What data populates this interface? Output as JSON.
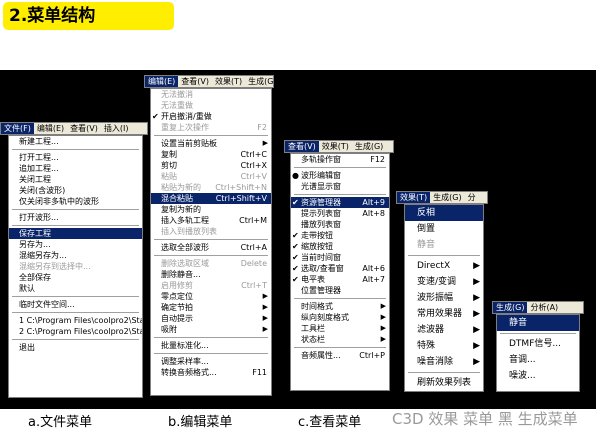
{
  "title": "2.菜单结构",
  "captions": [
    "a.文件菜单",
    "b.编辑菜单",
    "c.查看菜单",
    "d.效果菜单",
    "e.生成菜单"
  ],
  "watermark": "C3D 效果 菜单 黑 生成菜单",
  "file_menu": {
    "menubar": [
      "文件(F)",
      "编辑(E)",
      "查看(V)",
      "插入(I)"
    ],
    "items": [
      {
        "label": "新建工程..."
      },
      {
        "sep": true
      },
      {
        "label": "打开工程..."
      },
      {
        "label": "追加工程..."
      },
      {
        "label": "关闭工程"
      },
      {
        "label": "关闭(含波形)"
      },
      {
        "label": "仅关闭非多轨中的波形"
      },
      {
        "sep": true
      },
      {
        "label": "打开波形..."
      },
      {
        "sep": true
      },
      {
        "label": "保存工程",
        "hl": true
      },
      {
        "label": "另存为..."
      },
      {
        "label": "混缩另存为..."
      },
      {
        "label": "混缩另存到选择中...",
        "dis": true
      },
      {
        "label": "全部保存"
      },
      {
        "label": "默认"
      },
      {
        "sep": true
      },
      {
        "label": "临时文件空间..."
      },
      {
        "sep": true
      },
      {
        "label": "1 C:\\Program Files\\coolpro2\\Startu"
      },
      {
        "label": "2 C:\\Program Files\\coolpro2\\Startu"
      },
      {
        "sep": true
      },
      {
        "label": "退出"
      }
    ]
  },
  "edit_menu": {
    "menubar": [
      "编辑(E)",
      "查看(V)",
      "效果(T)",
      "生成(G)"
    ],
    "items": [
      {
        "label": "无法撤消",
        "dis": true
      },
      {
        "label": "无法重做",
        "dis": true
      },
      {
        "label": "开启撤消/重做",
        "chk": true
      },
      {
        "label": "重复上次操作",
        "sc": "F2",
        "dis": true
      },
      {
        "sep": true
      },
      {
        "label": "设置当前剪贴板",
        "arrow": true
      },
      {
        "label": "复制",
        "sc": "Ctrl+C"
      },
      {
        "label": "剪切",
        "sc": "Ctrl+X"
      },
      {
        "label": "粘贴",
        "sc": "Ctrl+V",
        "dis": true
      },
      {
        "label": "粘贴为新的",
        "sc": "Ctrl+Shift+N",
        "dis": true
      },
      {
        "label": "混合粘贴",
        "sc": "Ctrl+Shift+V",
        "hl": true
      },
      {
        "label": "复制为新的"
      },
      {
        "label": "插入多轨工程",
        "sc": "Ctrl+M"
      },
      {
        "label": "插入到播放列表",
        "dis": true
      },
      {
        "sep": true
      },
      {
        "label": "选取全部波形",
        "sc": "Ctrl+A"
      },
      {
        "sep": true
      },
      {
        "label": "删除选取区域",
        "sc": "Delete",
        "dis": true
      },
      {
        "label": "删除静音..."
      },
      {
        "label": "启用修剪",
        "sc": "Ctrl+T",
        "dis": true
      },
      {
        "label": "零点定位",
        "arrow": true
      },
      {
        "label": "确定节拍",
        "arrow": true
      },
      {
        "label": "自动提示",
        "arrow": true
      },
      {
        "label": "吸附",
        "arrow": true
      },
      {
        "sep": true
      },
      {
        "label": "批量标准化..."
      },
      {
        "sep": true
      },
      {
        "label": "调整采样率..."
      },
      {
        "label": "转换音频格式...",
        "sc": "F11"
      }
    ]
  },
  "view_menu": {
    "menubar": [
      "查看(V)",
      "效果(T)",
      "生成(G)"
    ],
    "items": [
      {
        "label": "多轨操作窗",
        "sc": "F12"
      },
      {
        "sep": true
      },
      {
        "label": "波形编辑窗",
        "dot": true
      },
      {
        "label": "光谱显示窗"
      },
      {
        "sep": true
      },
      {
        "label": "资源管理器",
        "sc": "Alt+9",
        "chk": true,
        "hl": true
      },
      {
        "label": "提示列表窗",
        "sc": "Alt+8"
      },
      {
        "label": "播放列表窗"
      },
      {
        "label": "走带按钮",
        "chk": true
      },
      {
        "label": "缩放按钮",
        "chk": true
      },
      {
        "label": "当前时间窗",
        "chk": true
      },
      {
        "label": "选取/查看窗",
        "sc": "Alt+6",
        "chk": true
      },
      {
        "label": "电平表",
        "sc": "Alt+7",
        "chk": true
      },
      {
        "label": "位置管理器"
      },
      {
        "sep": true
      },
      {
        "label": "时间格式",
        "arrow": true
      },
      {
        "label": "纵向刻度格式",
        "arrow": true
      },
      {
        "label": "工具栏",
        "arrow": true
      },
      {
        "label": "状态栏",
        "arrow": true
      },
      {
        "sep": true
      },
      {
        "label": "音频属性...",
        "sc": "Ctrl+P"
      }
    ]
  },
  "effects_menu": {
    "menubar": [
      "效果(T)",
      "生成(G)",
      "分"
    ],
    "items": [
      {
        "label": "反相",
        "hl": true
      },
      {
        "label": "倒置"
      },
      {
        "label": "静音",
        "dis": true
      },
      {
        "sep": true
      },
      {
        "label": "DirectX",
        "arrow": true
      },
      {
        "label": "变速/变调",
        "arrow": true
      },
      {
        "label": "波形振幅",
        "arrow": true
      },
      {
        "label": "常用效果器",
        "arrow": true
      },
      {
        "label": "滤波器",
        "arrow": true
      },
      {
        "label": "特殊",
        "arrow": true
      },
      {
        "label": "噪音消除",
        "arrow": true
      },
      {
        "sep": true
      },
      {
        "label": "刷新效果列表"
      }
    ]
  },
  "gen_menu": {
    "menubar": [
      "生成(G)",
      "分析(A)"
    ],
    "items": [
      {
        "label": "静音",
        "hl": true
      },
      {
        "sep": true
      },
      {
        "label": "DTMF信号..."
      },
      {
        "label": "音调..."
      },
      {
        "label": "噪波..."
      }
    ]
  },
  "colors": {
    "highlight": "#0a246a",
    "title_bg": "#ffee00",
    "stage_bg": "#000000"
  }
}
